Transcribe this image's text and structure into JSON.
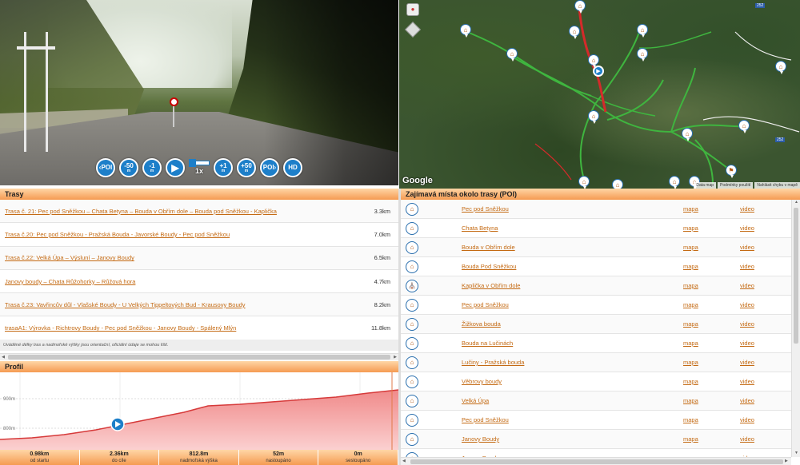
{
  "video": {
    "controls": [
      {
        "id": "prev-poi",
        "label": "POI",
        "prefix": "‹",
        "sub": ""
      },
      {
        "id": "back-50m",
        "label": "-50",
        "sub": "m"
      },
      {
        "id": "back-1m",
        "label": "-1",
        "sub": "m"
      },
      {
        "id": "play",
        "label": "▶",
        "sub": ""
      },
      {
        "id": "fwd-1m",
        "label": "+1",
        "sub": "m"
      },
      {
        "id": "fwd-50m",
        "label": "+50",
        "sub": "m"
      },
      {
        "id": "next-poi",
        "label": "POI",
        "prefix": "›",
        "sub": ""
      },
      {
        "id": "hd",
        "label": "HD",
        "sub": ""
      }
    ],
    "speed": "1x"
  },
  "map": {
    "google_label": "Google",
    "footer": [
      "Data map",
      "Podmínky použití",
      "Nahlásit chybu v mapě"
    ],
    "road_numbers": [
      "252",
      "252"
    ]
  },
  "routes": {
    "title": "Trasy",
    "items": [
      {
        "name": "Trasa č. 21: Pec pod Sněžkou – Chata Betyna – Bouda v Obřím dole – Bouda pod Sněžkou - Kaplička",
        "length": "3.3km"
      },
      {
        "name": "Trasa č.20: Pec pod Sněžkou - Pražská Bouda - Javorské Boudy - Pec pod Sněžkou",
        "length": "7.0km"
      },
      {
        "name": "Trasa č.22: Velká Úpa – Výsluní – Janovy Boudy",
        "length": "6.5km"
      },
      {
        "name": "Janovy boudy – Chata Růžohorky – Růžová hora",
        "length": "4.7km"
      },
      {
        "name": "Trasa č.23: Vavřincův důl - Vlašské Boudy - U Velkých Tippeltových Bud - Krausovy Boudy",
        "length": "8.2km"
      },
      {
        "name": "trasaA1: Výrovka - Richtrovy Boudy - Pec pod Sněžkou - Janovy Boudy - Spálený Mlýn",
        "length": "11.8km"
      }
    ],
    "note": "Uváděné délky tras a nadmořské výšky jsou orientační, oficiální údaje se mohou lišit."
  },
  "profile": {
    "title": "Profil",
    "y_labels": [
      "900m",
      "800m"
    ],
    "stats": [
      {
        "value": "0.98km",
        "label": "od startu"
      },
      {
        "value": "2.36km",
        "label": "do cíle"
      },
      {
        "value": "812.8m",
        "label": "nadmořská výška"
      },
      {
        "value": "52m",
        "label": "nastoupáno"
      },
      {
        "value": "0m",
        "label": "sestoupáno"
      }
    ]
  },
  "poi": {
    "title": "Zajímavá místa okolo trasy (POI)",
    "map_label": "mapa",
    "video_label": "video",
    "items": [
      {
        "name": "Pec pod Sněžkou",
        "icon": "house-icon"
      },
      {
        "name": "Chata Betyna",
        "icon": "house-icon"
      },
      {
        "name": "Bouda v Obřím dole",
        "icon": "house-icon"
      },
      {
        "name": "Bouda Pod Sněžkou",
        "icon": "house-icon"
      },
      {
        "name": "Kaplička v Obřím dole",
        "icon": "chapel-icon"
      },
      {
        "name": "Pec pod Sněžkou",
        "icon": "house-icon"
      },
      {
        "name": "Žižkova bouda",
        "icon": "house-icon"
      },
      {
        "name": "Bouda na Lučinách",
        "icon": "house-icon"
      },
      {
        "name": "Lučiny - Pražská bouda",
        "icon": "house-icon"
      },
      {
        "name": "Věbrovy boudy",
        "icon": "house-icon"
      },
      {
        "name": "Velká Úpa",
        "icon": "house-icon"
      },
      {
        "name": "Pec pod Sněžkou",
        "icon": "house-icon"
      },
      {
        "name": "Janovy Boudy",
        "icon": "house-icon"
      },
      {
        "name": "Janovy Boudy",
        "icon": "house-icon"
      }
    ]
  }
}
